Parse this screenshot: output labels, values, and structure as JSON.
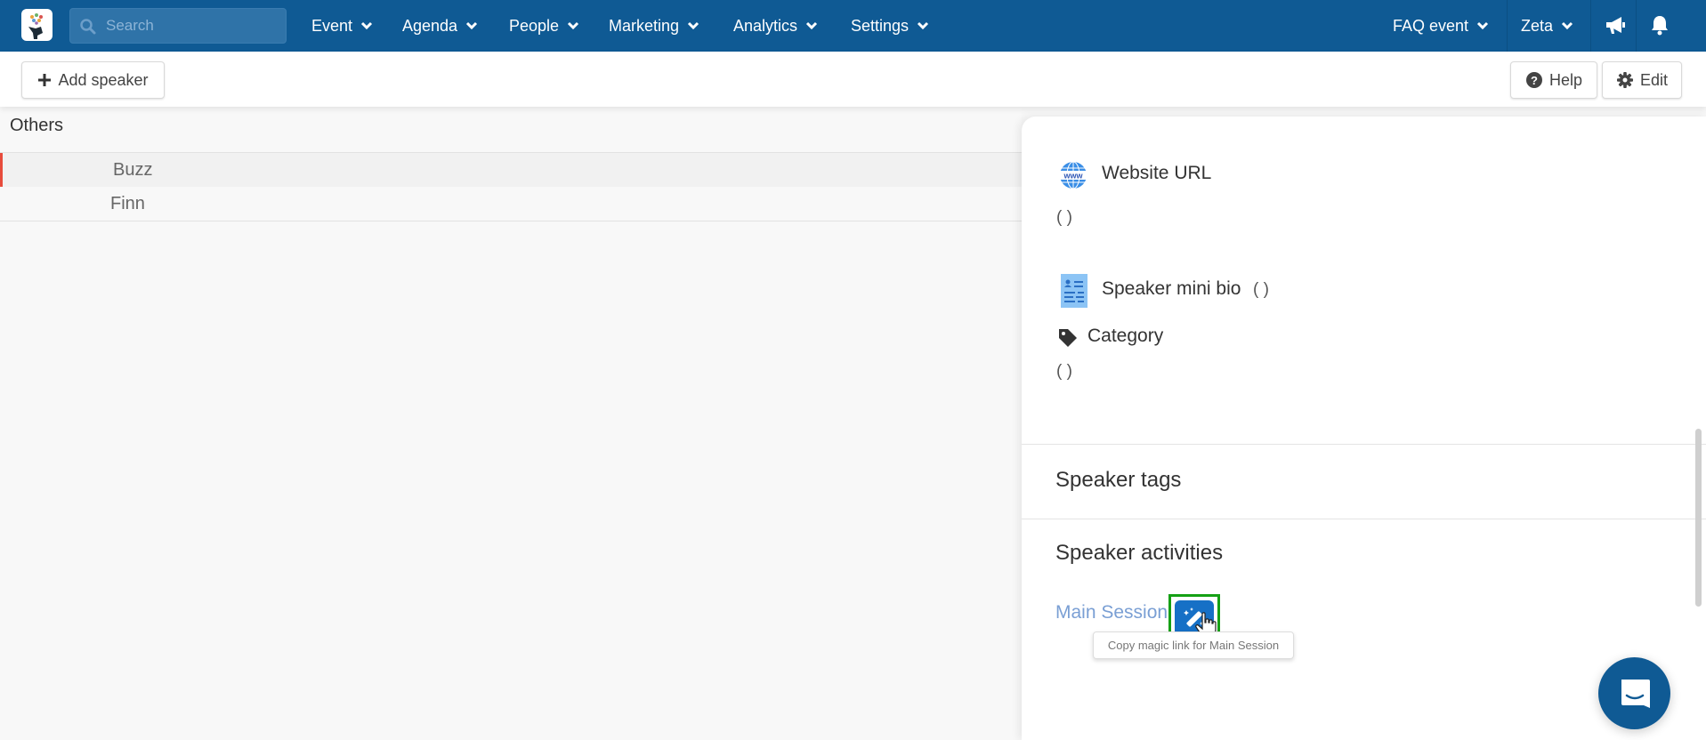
{
  "nav": {
    "search_placeholder": "Search",
    "menu": [
      {
        "label": "Event"
      },
      {
        "label": "Agenda"
      },
      {
        "label": "People"
      },
      {
        "label": "Marketing"
      },
      {
        "label": "Analytics"
      },
      {
        "label": "Settings"
      }
    ],
    "event_selector": "FAQ event",
    "user_menu": "Zeta",
    "icons": {
      "announcements": "megaphone-icon",
      "notifications": "bell-icon"
    }
  },
  "toolbar": {
    "add_label": "Add speaker",
    "help_label": "Help",
    "edit_label": "Edit"
  },
  "list": {
    "group_title": "Others",
    "speakers": [
      {
        "name": "Buzz",
        "active": true
      },
      {
        "name": "Finn",
        "active": false
      }
    ]
  },
  "panel": {
    "website_label": "Website URL",
    "website_value": "( )",
    "bio_label": "Speaker mini bio",
    "bio_value": "( )",
    "category_label": "Category",
    "category_value": "( )",
    "tags_title": "Speaker tags",
    "activities_title": "Speaker activities",
    "activities": [
      {
        "label": "Main Session",
        "tooltip": "Copy magic link for Main Session"
      }
    ]
  },
  "colors": {
    "nav_bg": "#0f5a94",
    "active_marker": "#e74c3c",
    "link": "#7a9fd4",
    "magic_button": "#1670c6",
    "highlight_outline": "#15a015"
  }
}
